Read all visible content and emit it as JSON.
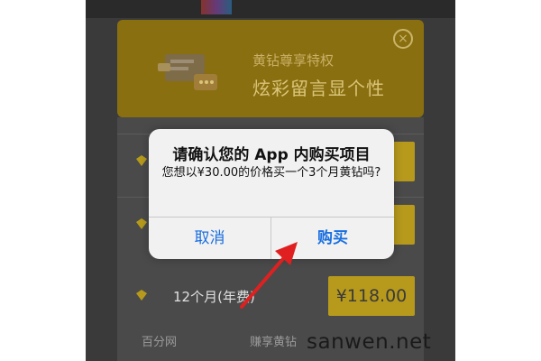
{
  "background_card": {
    "title": "黄钻尊享特权",
    "subtitle": "炫彩留言显个性"
  },
  "purchase_options": [
    {
      "label": "",
      "price": ""
    },
    {
      "label": "",
      "price": ""
    },
    {
      "label": "12个月(年费)",
      "price": "¥118.00"
    }
  ],
  "bottom_labels": [
    "百分网",
    "赚享黄钻"
  ],
  "alert": {
    "title": "请确认您的 App 内购买项目",
    "message": "您想以¥30.00的价格买一个3个月黄钻吗?",
    "cancel_label": "取消",
    "buy_label": "购买"
  },
  "watermark": "sanwen.net",
  "colors": {
    "accent_blue": "#1a6fe0",
    "arrow_red": "#e02020",
    "gold": "#b79a1c"
  },
  "icons": {
    "close": "close-icon",
    "diamond": "diamond-icon",
    "chat": "chat-bubble-icon"
  }
}
